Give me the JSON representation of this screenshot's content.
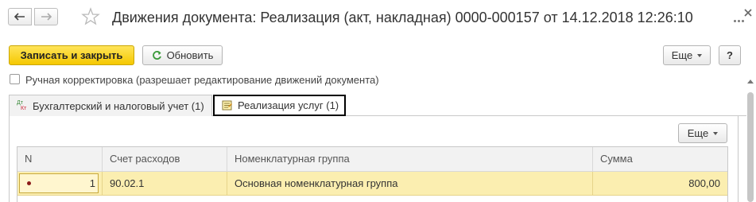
{
  "header": {
    "title": "Движения документа: Реализация (акт, накладная) 0000-000157 от 14.12.2018 12:26:10"
  },
  "toolbar": {
    "save_close_label": "Записать и закрыть",
    "refresh_label": "Обновить",
    "more_label": "Еще",
    "help_label": "?"
  },
  "manual_correction": {
    "label": "Ручная корректировка (разрешает редактирование движений документа)",
    "checked": false
  },
  "tabs": [
    {
      "label": "Бухгалтерский и налоговый учет (1)",
      "icon": "dt-kt-icon",
      "active": false
    },
    {
      "label": "Реализация услуг (1)",
      "icon": "register-icon",
      "active": true
    }
  ],
  "table_toolbar": {
    "more_label": "Еще"
  },
  "table": {
    "columns": [
      "N",
      "Счет расходов",
      "Номенклатурная группа",
      "Сумма"
    ],
    "rows": [
      {
        "n": "1",
        "account": "90.02.1",
        "group": "Основная номенклатурная группа",
        "sum": "800,00"
      }
    ]
  },
  "colors": {
    "primary_button": "#f5c800",
    "selected_row": "#fbeeb0",
    "active_tab_border": "#000000"
  }
}
